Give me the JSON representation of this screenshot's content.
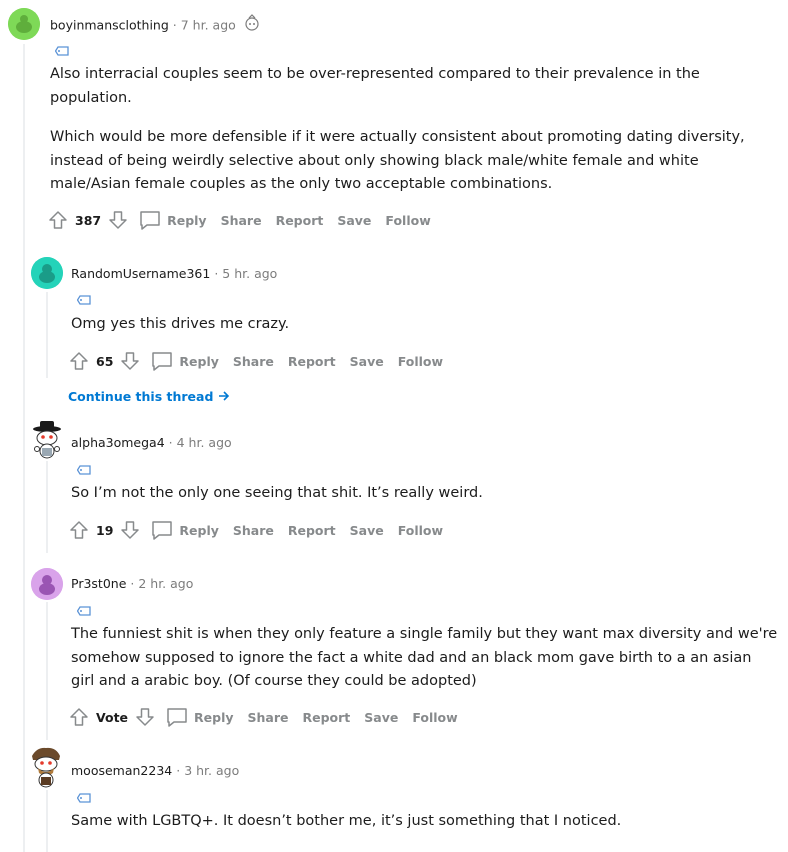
{
  "comments": [
    {
      "author": "boyinmansclothing",
      "time": "7 hr. ago",
      "body": [
        "Also interracial couples seem to be over-represented compared to their prevalence in the population.",
        "Which would be more defensible if it were actually consistent about promoting dating diversity, instead of being weirdly selective about only showing black male/white female and white male/Asian female couples as the only two acceptable combinations."
      ],
      "score": "387",
      "avatar_color": "#7ed957"
    },
    {
      "author": "RandomUsername361",
      "time": "5 hr. ago",
      "body": [
        "Omg yes this drives me crazy."
      ],
      "score": "65",
      "avatar_color": "#24d3b9"
    },
    {
      "author": "alpha3omega4",
      "time": "4 hr. ago",
      "body": [
        "So I’m not the only one seeing that shit. It’s really weird."
      ],
      "score": "19",
      "avatar_color": "#ffffff"
    },
    {
      "author": "Pr3st0ne",
      "time": "2 hr. ago",
      "body": [
        "The funniest shit is when they only feature a single family but they want max diversity and we're somehow supposed to ignore the fact a white dad and an black mom gave birth to a an asian girl and a arabic boy. (Of course they could be adopted)"
      ],
      "score": "Vote",
      "avatar_color": "#d9a3ea"
    },
    {
      "author": "mooseman2234",
      "time": "3 hr. ago",
      "body": [
        "Same with LGBTQ+. It doesn’t bother me, it’s just something that I noticed."
      ],
      "avatar_color": "#ffffff"
    }
  ],
  "actions": {
    "reply": "Reply",
    "share": "Share",
    "report": "Report",
    "save": "Save",
    "follow": "Follow"
  },
  "continue_thread": "Continue this thread",
  "separator": "·",
  "colors": {
    "link": "#0079d3",
    "muted": "#878a8c",
    "thread_line": "#edeff1"
  }
}
